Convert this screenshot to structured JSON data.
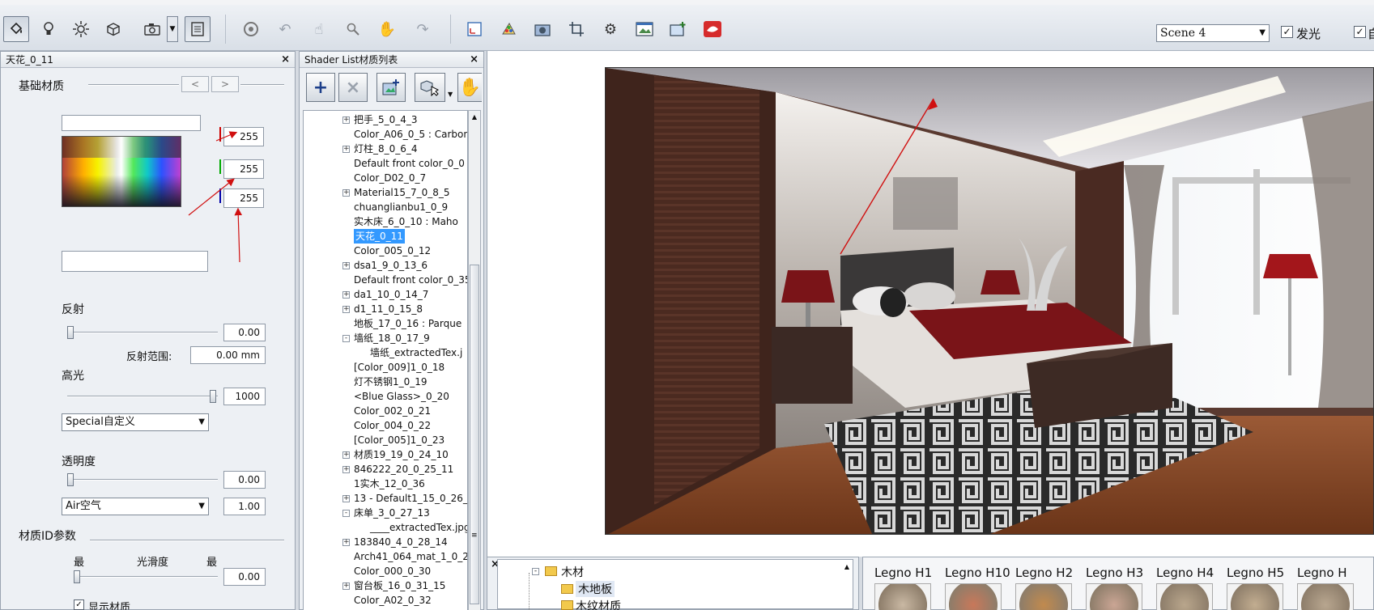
{
  "toolbar": {
    "scene_select": "Scene 4",
    "glow_label": "发光",
    "glow_checked": "✓",
    "right_checked": "✓",
    "right_label": "自"
  },
  "material_panel": {
    "title": "天花_0_11",
    "close": "×",
    "section_basic": "基础材质",
    "nav_prev": "<",
    "nav_next": ">",
    "rgb": {
      "r": "255",
      "g": "255",
      "b": "255"
    },
    "reflection_label": "反射",
    "reflection_value": "0.00",
    "reflection_range_label": "反射范围:",
    "reflection_range_value": "0.00 mm",
    "specular_label": "高光",
    "specular_value": "1000",
    "specular_mode": "Special自定义",
    "transparency_label": "透明度",
    "transparency_value": "0.00",
    "medium": "Air空气",
    "medium_value": "1.00",
    "material_id_label": "材质ID参数",
    "glossiness_min": "最",
    "glossiness_label": "光滑度",
    "glossiness_max": "最",
    "glossiness_value": "0.00",
    "show_material_label": "显示材质",
    "show_material_checked": "✓"
  },
  "shader_list": {
    "title": "Shader List材质列表",
    "close": "×",
    "add": "+",
    "remove": "×",
    "items": [
      {
        "label": "把手_5_0_4_3",
        "exp": "+"
      },
      {
        "label": "Color_A06_0_5 : Carbon",
        "exp": ""
      },
      {
        "label": "灯柱_8_0_6_4",
        "exp": "+"
      },
      {
        "label": "Default front color_0_0",
        "exp": ""
      },
      {
        "label": "Color_D02_0_7",
        "exp": ""
      },
      {
        "label": "Material15_7_0_8_5",
        "exp": "+"
      },
      {
        "label": "chuanglianbu1_0_9",
        "exp": ""
      },
      {
        "label": "实木床_6_0_10 : Maho",
        "exp": ""
      },
      {
        "label": "天花_0_11",
        "exp": "",
        "selected": true
      },
      {
        "label": "Color_005_0_12",
        "exp": ""
      },
      {
        "label": "dsa1_9_0_13_6",
        "exp": "+"
      },
      {
        "label": "Default front color_0_35",
        "exp": ""
      },
      {
        "label": "da1_10_0_14_7",
        "exp": "+"
      },
      {
        "label": "d1_11_0_15_8",
        "exp": "+"
      },
      {
        "label": "地板_17_0_16 : Parque",
        "exp": ""
      },
      {
        "label": "墙纸_18_0_17_9",
        "exp": "-"
      },
      {
        "label": "墙纸_extractedTex.j",
        "exp": "",
        "child": true
      },
      {
        "label": "[Color_009]1_0_18",
        "exp": ""
      },
      {
        "label": "灯不锈钢1_0_19",
        "exp": ""
      },
      {
        "label": "<Blue Glass>_0_20",
        "exp": ""
      },
      {
        "label": "Color_002_0_21",
        "exp": ""
      },
      {
        "label": "Color_004_0_22",
        "exp": ""
      },
      {
        "label": "[Color_005]1_0_23",
        "exp": ""
      },
      {
        "label": "材质19_19_0_24_10",
        "exp": "+"
      },
      {
        "label": "846222_20_0_25_11",
        "exp": "+"
      },
      {
        "label": "1实木_12_0_36",
        "exp": ""
      },
      {
        "label": "13 - Default1_15_0_26_",
        "exp": "+"
      },
      {
        "label": "床单_3_0_27_13",
        "exp": "-"
      },
      {
        "label": "____extractedTex.jpg",
        "exp": "",
        "child": true
      },
      {
        "label": "183840_4_0_28_14",
        "exp": "+"
      },
      {
        "label": "Arch41_064_mat_1_0_2",
        "exp": ""
      },
      {
        "label": "Color_000_0_30",
        "exp": ""
      },
      {
        "label": "窗台板_16_0_31_15",
        "exp": "+"
      },
      {
        "label": "Color_A02_0_32",
        "exp": ""
      }
    ]
  },
  "library_tree": {
    "close": "×",
    "items": [
      {
        "label": "木材"
      },
      {
        "label": "木地板"
      },
      {
        "label": "木纹材质"
      }
    ]
  },
  "library_thumbs": {
    "items": [
      {
        "label": "Legno H1",
        "color": "#c9b8a3"
      },
      {
        "label": "Legno H10",
        "color": "#c8785a"
      },
      {
        "label": "Legno H2",
        "color": "#c18a4e"
      },
      {
        "label": "Legno H3",
        "color": "#caa594"
      },
      {
        "label": "Legno H4",
        "color": "#b9a68c"
      },
      {
        "label": "Legno H5",
        "color": "#c2ad90"
      },
      {
        "label": "Legno H",
        "color": "#b8a68f"
      }
    ]
  }
}
